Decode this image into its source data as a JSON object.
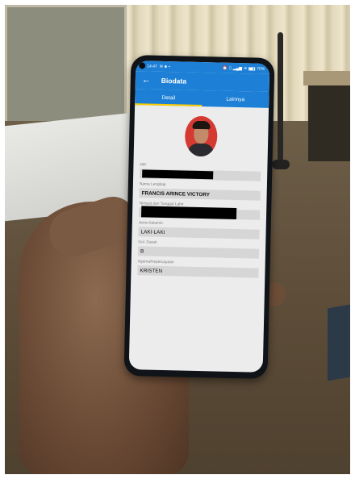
{
  "status_bar": {
    "time": "14.47",
    "icons_left": [
      "mail-icon",
      "app-badge-icon",
      "more-dot-icon"
    ],
    "icons_right": [
      "alarm-icon",
      "vibrate-icon",
      "signal-icon",
      "wifi-icon"
    ],
    "battery": "70%"
  },
  "appbar": {
    "title": "Biodata"
  },
  "tabs": [
    {
      "label": "Detail",
      "active": true
    },
    {
      "label": "Lainnya",
      "active": false
    }
  ],
  "fields": {
    "nik": {
      "label": "NIK",
      "value": ""
    },
    "nama": {
      "label": "Nama Lengkap",
      "value": "FRANCIS ARINCE VICTORY"
    },
    "ttl": {
      "label": "Tempat dan Tanggal Lahir",
      "value": ""
    },
    "jk": {
      "label": "Jenis Kelamin",
      "value": "LAKI-LAKI"
    },
    "darah": {
      "label": "Gol. Darah",
      "value": "B"
    },
    "agama": {
      "label": "Agama/Kepercayaan",
      "value": "KRISTEN"
    }
  },
  "colors": {
    "primary": "#1d80d6",
    "tab_indicator": "#ffcc00",
    "photo_bg": "#d43a32"
  }
}
